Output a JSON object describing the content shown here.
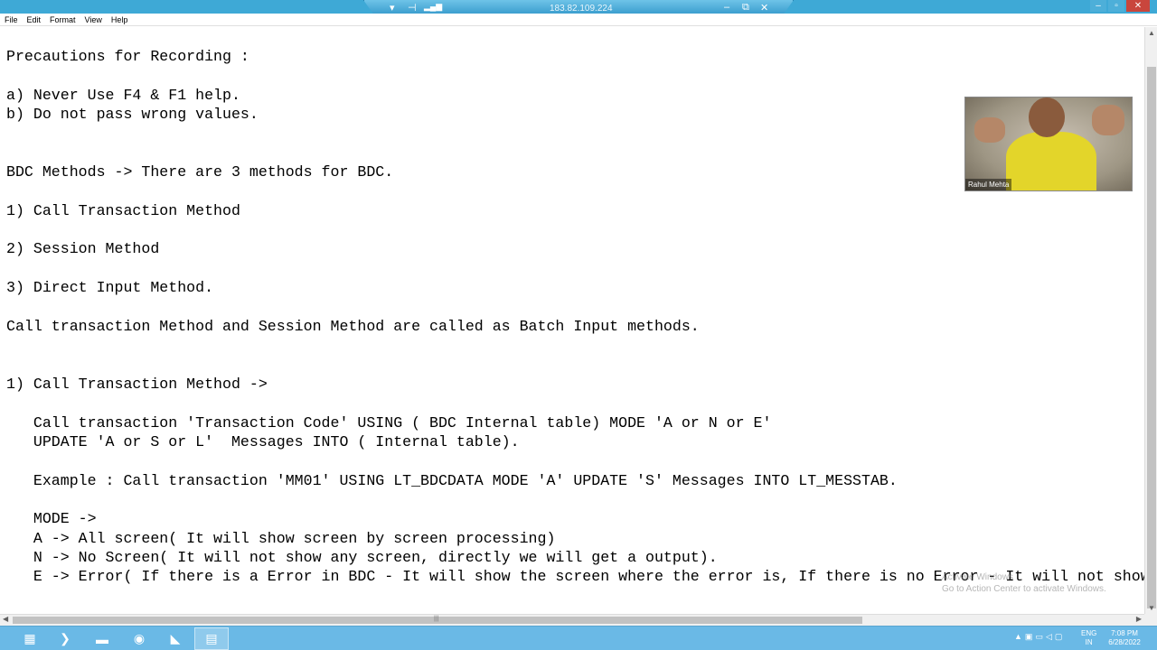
{
  "titlebar": {
    "connection_ip": "183.82.109.224",
    "pin_icon": "pin-icon",
    "minimize_glyph": "–",
    "restore_glyph": "⧉",
    "close_glyph": "✕"
  },
  "menu": {
    "items": [
      "File",
      "Edit",
      "Format",
      "View",
      "Help"
    ]
  },
  "editor": {
    "lines": [
      "Precautions for Recording :",
      "",
      "a) Never Use F4 & F1 help.",
      "b) Do not pass wrong values.",
      "",
      "",
      "BDC Methods -> There are 3 methods for BDC.",
      "",
      "1) Call Transaction Method",
      "",
      "2) Session Method",
      "",
      "3) Direct Input Method.",
      "",
      "Call transaction Method and Session Method are called as Batch Input methods.",
      "",
      "",
      "1) Call Transaction Method ->",
      "",
      "   Call transaction 'Transaction Code' USING ( BDC Internal table) MODE 'A or N or E'",
      "   UPDATE 'A or S or L'  Messages INTO ( Internal table).",
      "",
      "   Example : Call transaction 'MM01' USING LT_BDCDATA MODE 'A' UPDATE 'S' Messages INTO LT_MESSTAB.",
      "",
      "   MODE ->",
      "   A -> All screen( It will show screen by screen processing)",
      "   N -> No Screen( It will not show any screen, directly we will get a output).",
      "   E -> Error( If there is a Error in BDC - It will show the screen where the error is, If there is no Error - It will not show"
    ]
  },
  "video": {
    "participant_name": "Rahul Mehta"
  },
  "watermark": {
    "line1": "Activate Windows",
    "line2": "Go to Action Center to activate Windows."
  },
  "taskbar": {
    "language": "ENG",
    "region": "IN",
    "time": "7:08 PM",
    "date": "6/28/2022"
  }
}
